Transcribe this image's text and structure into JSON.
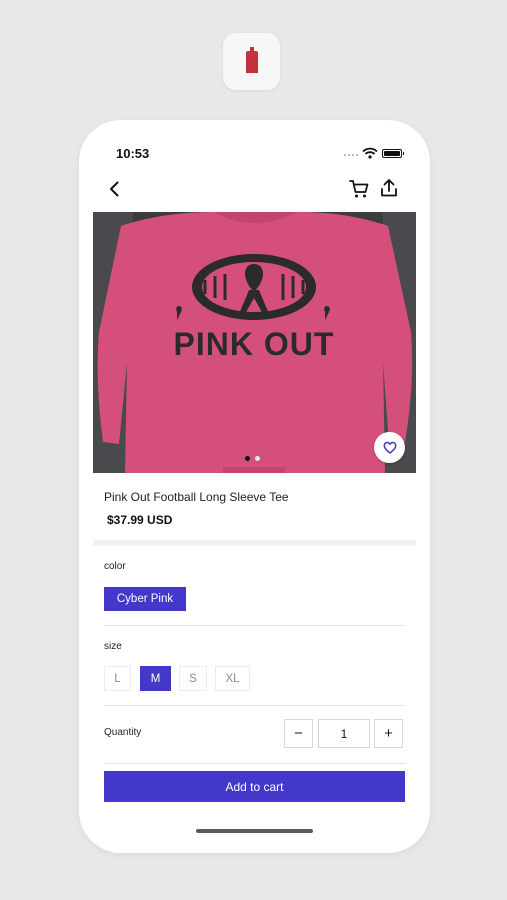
{
  "status_bar": {
    "time": "10:53"
  },
  "product": {
    "image_text": "PINK OUT",
    "title": "Pink Out Football Long Sleeve Tee",
    "price": "$37.99 USD",
    "image_count": 2,
    "active_image": 1
  },
  "options": {
    "color_label": "color",
    "color_selected": "Cyber Pink",
    "size_label": "size",
    "sizes": [
      "L",
      "M",
      "S",
      "XL"
    ],
    "size_selected": "M"
  },
  "quantity": {
    "label": "Quantity",
    "decrement": "−",
    "value": "1",
    "increment": "+"
  },
  "actions": {
    "add_to_cart": "Add to cart"
  },
  "icons": {
    "back": "chevron-left-icon",
    "cart": "cart-icon",
    "share": "share-icon",
    "favorite": "heart-icon"
  },
  "colors": {
    "accent": "#4338ca",
    "shirt": "#d4507a",
    "print": "#2b2b2b"
  }
}
